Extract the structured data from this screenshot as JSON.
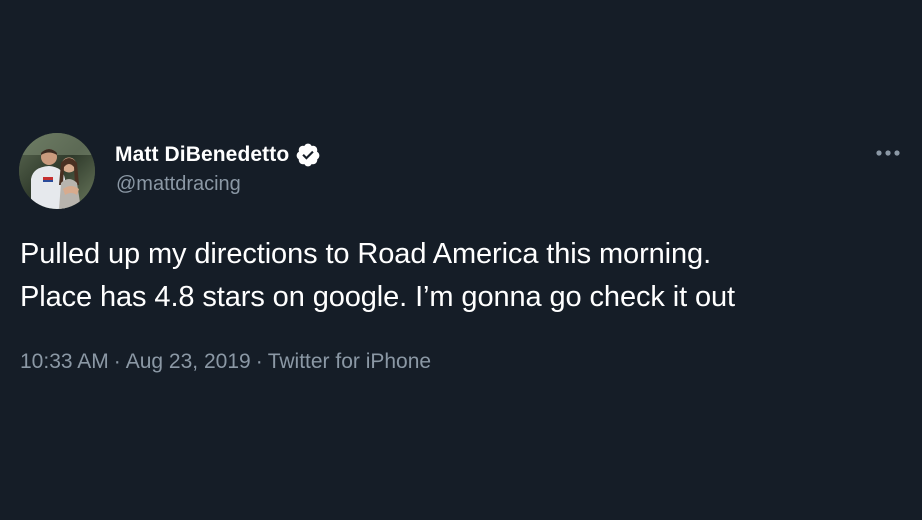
{
  "author": {
    "display_name": "Matt DiBenedetto",
    "handle": "@mattdracing",
    "verified": true,
    "avatar_icon": "profile-photo"
  },
  "tweet": {
    "lines": [
      "Pulled up my directions to Road America this morning.",
      "Place has 4.8 stars on google. I’m gonna go check it out"
    ]
  },
  "meta": {
    "time": "10:33 AM",
    "date": "Aug 23, 2019",
    "source": "Twitter for iPhone",
    "separator": "·"
  },
  "icons": {
    "verified": "verified-badge-icon",
    "more": "more-options-icon"
  },
  "colors": {
    "background": "#151d27",
    "text": "#ffffff",
    "secondary": "#8b98a5"
  }
}
